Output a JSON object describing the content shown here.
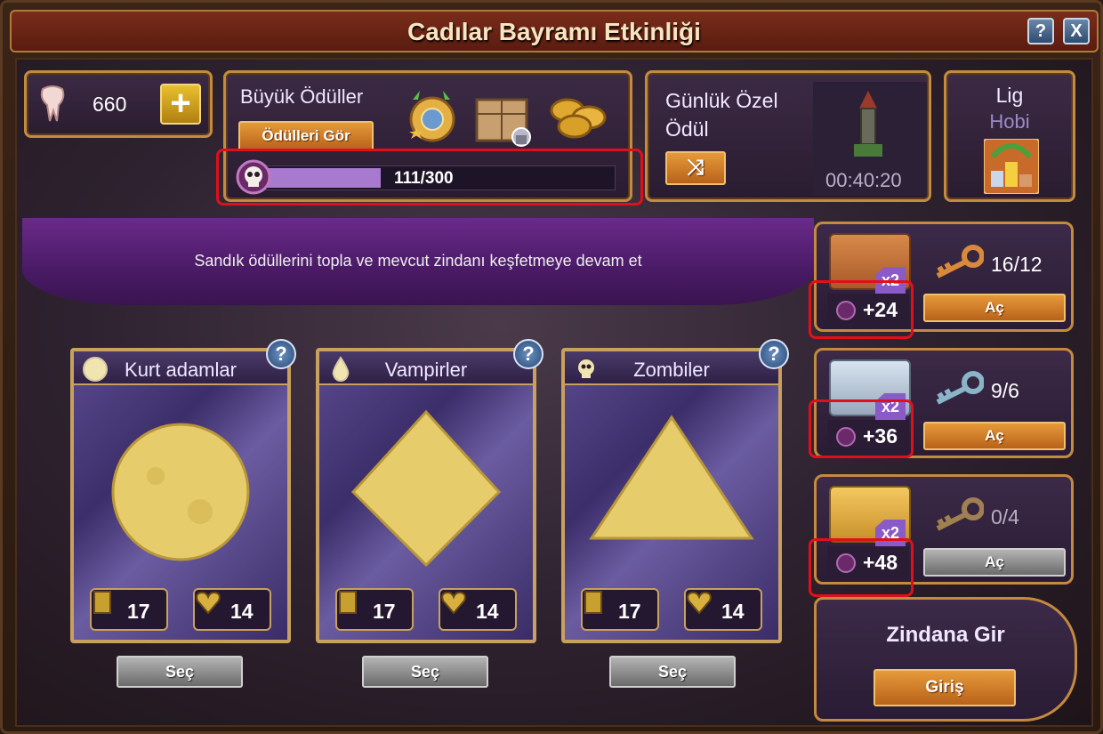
{
  "window": {
    "title": "Cadılar Bayramı Etkinliği",
    "help_label": "?",
    "close_label": "X"
  },
  "currency": {
    "value": "660",
    "add_label": "+"
  },
  "grand_prizes": {
    "title": "Büyük Ödüller",
    "view_button": "Ödülleri Gör",
    "progress_text": "111/300",
    "progress_fraction": 0.37
  },
  "daily": {
    "title_line1": "Günlük Özel",
    "title_line2": "Ödül",
    "timer": "00:40:20"
  },
  "league": {
    "title": "Lig",
    "subtitle": "Hobi"
  },
  "banner": {
    "text": "Sandık ödüllerini topla ve mevcut zindanı keşfetmeye devam et"
  },
  "cards": [
    {
      "name": "Kurt adamlar",
      "shape": "circle",
      "cards": "17",
      "hearts": "14",
      "select": "Seç",
      "help": "?"
    },
    {
      "name": "Vampirler",
      "shape": "diamond",
      "cards": "17",
      "hearts": "14",
      "select": "Seç",
      "help": "?"
    },
    {
      "name": "Zombiler",
      "shape": "triangle",
      "cards": "17",
      "hearts": "14",
      "select": "Seç",
      "help": "?"
    }
  ],
  "chests": [
    {
      "multiplier": "x2",
      "bonus": "+24",
      "keys": "16/12",
      "open": "Aç",
      "active": true,
      "color": "#c87a3a",
      "key_color": "#d88a3a"
    },
    {
      "multiplier": "x2",
      "bonus": "+36",
      "keys": "9/6",
      "open": "Aç",
      "active": true,
      "color": "#b8c8dc",
      "key_color": "#8ab4c8"
    },
    {
      "multiplier": "x2",
      "bonus": "+48",
      "keys": "0/4",
      "open": "Aç",
      "active": false,
      "color": "#e0aa3a",
      "key_color": "#a08050"
    }
  ],
  "dungeon": {
    "title": "Zindana Gir",
    "enter": "Giriş"
  },
  "colors": {
    "accent_orange": "#d8842a",
    "progress_purple": "#a77ad0",
    "highlight_red": "#e0101a",
    "frame_gold": "#c48a3e"
  }
}
